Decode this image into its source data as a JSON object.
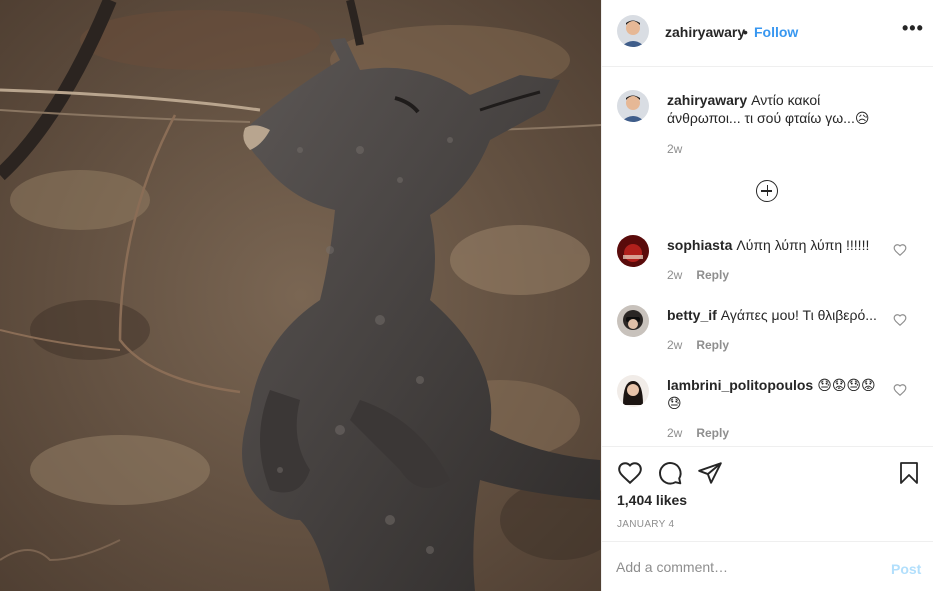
{
  "post": {
    "author": {
      "username": "zahiryawary",
      "separator": "•",
      "follow_label": "Follow",
      "more_icon": "more-dots-icon"
    },
    "caption": {
      "username": "zahiryawary",
      "text": "Αντίο κακοί άνθρωποι... τι σού φταίω γω...😥",
      "time": "2w"
    },
    "load_more_icon": "plus-circle-icon",
    "comments": [
      {
        "username": "sophiasta",
        "text": "Λύπη λύπη λύπη !!!!!!",
        "time": "2w",
        "reply_label": "Reply"
      },
      {
        "username": "betty_if",
        "text": "Αγάπες μου! Τι θλιβερό...",
        "time": "2w",
        "reply_label": "Reply"
      },
      {
        "username": "lambrini_politopoulos",
        "text": "😓😟😓😟 😓",
        "time": "2w",
        "reply_label": "Reply"
      }
    ],
    "likes": "1,404 likes",
    "date": "JANUARY 4",
    "add_comment": {
      "placeholder": "Add a comment…",
      "value": "",
      "post_label": "Post"
    },
    "icons": [
      "heart-icon",
      "comment-icon",
      "share-icon",
      "bookmark-icon"
    ],
    "colors": {
      "link": "#3897f0",
      "muted": "#8e8e8e",
      "post_disabled": "#b2dffc",
      "border": "#efefef"
    }
  }
}
